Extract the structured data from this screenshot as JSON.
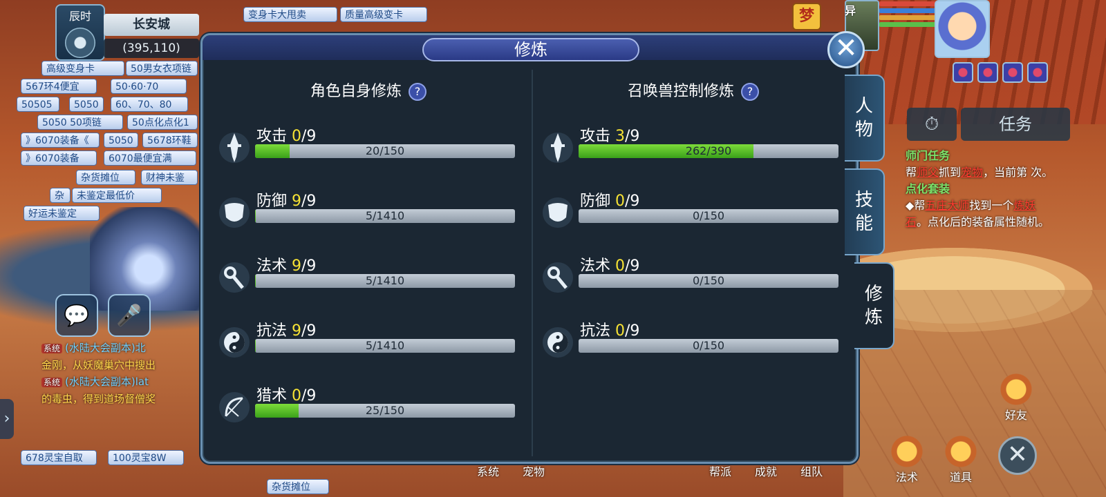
{
  "hud": {
    "time_label": "辰时",
    "city": "长安城",
    "coords": "(395,110)",
    "dream_badge": "梦",
    "pet_label": "异"
  },
  "stalls": [
    "高级变身卡",
    "50男女衣项链",
    "567环4便宜",
    "50·60·70",
    "50505",
    "5050",
    "60、70、80",
    "5050 50项链",
    "50点化点化1",
    "》6070装备《",
    "5050",
    "5678环鞋",
    "》6070装备",
    "6070最便宜满",
    "杂货摊位",
    "财神未鉴",
    "杂",
    "未鉴定最低价",
    "好运未鉴定",
    "变身卡大甩卖",
    "质量高级变卡",
    "678灵宝自取",
    "100灵宝8W",
    "杂货摊位"
  ],
  "chat": {
    "line1_tag": "系统",
    "line1_text": "(水陆大会副本)北",
    "line2_text": "金刚，从妖魔巢穴中搜出",
    "line3_tag": "系统",
    "line3_text": "(水陆大会副本)lat",
    "line4_text": "的毒虫，得到道场督僧奖"
  },
  "quest": {
    "timer_icon": "stopwatch-icon",
    "task_tab": "任务",
    "q1_title": "师门任务",
    "q1_a": "帮",
    "q1_link1": "师父",
    "q1_b": "抓到",
    "q1_link2": "宠物",
    "q1_c": "，当前第 次。",
    "q2_title": "点化套装",
    "q2_a": "◆帮",
    "q2_link1": "五庄大师",
    "q2_b": "找到一个",
    "q2_link2": "炼妖石",
    "q2_c": "。点化后的装备属性随机。"
  },
  "right_buttons": {
    "friends": "好友",
    "spells": "法术",
    "items": "道具"
  },
  "bottom_menu": [
    "系统",
    "宠物",
    "",
    "帮派",
    "成就",
    "组队"
  ],
  "modal": {
    "title": "修炼",
    "close_label": "✕",
    "left": {
      "heading": "角色自身修炼",
      "rows": [
        {
          "name": "攻击",
          "level": "0",
          "max": "/9",
          "progress": "20/150",
          "fraction": 0.133,
          "icon": "sword-icon"
        },
        {
          "name": "防御",
          "level": "9",
          "max": "/9",
          "progress": "5/1410",
          "fraction": 0.0035,
          "icon": "shield-icon"
        },
        {
          "name": "法术",
          "level": "9",
          "max": "/9",
          "progress": "5/1410",
          "fraction": 0.0035,
          "icon": "staff-icon"
        },
        {
          "name": "抗法",
          "level": "9",
          "max": "/9",
          "progress": "5/1410",
          "fraction": 0.0035,
          "icon": "yinyang-icon"
        },
        {
          "name": "猎术",
          "level": "0",
          "max": "/9",
          "progress": "25/150",
          "fraction": 0.167,
          "icon": "bow-icon"
        }
      ]
    },
    "right": {
      "heading": "召唤兽控制修炼",
      "rows": [
        {
          "name": "攻击",
          "level": "3",
          "max": "/9",
          "progress": "262/390",
          "fraction": 0.672,
          "icon": "sword-icon"
        },
        {
          "name": "防御",
          "level": "0",
          "max": "/9",
          "progress": "0/150",
          "fraction": 0,
          "icon": "shield-icon"
        },
        {
          "name": "法术",
          "level": "0",
          "max": "/9",
          "progress": "0/150",
          "fraction": 0,
          "icon": "staff-icon"
        },
        {
          "name": "抗法",
          "level": "0",
          "max": "/9",
          "progress": "0/150",
          "fraction": 0,
          "icon": "yinyang-icon"
        }
      ]
    },
    "help_label": "?",
    "side_tabs": [
      "人物",
      "技能",
      "修炼"
    ]
  }
}
